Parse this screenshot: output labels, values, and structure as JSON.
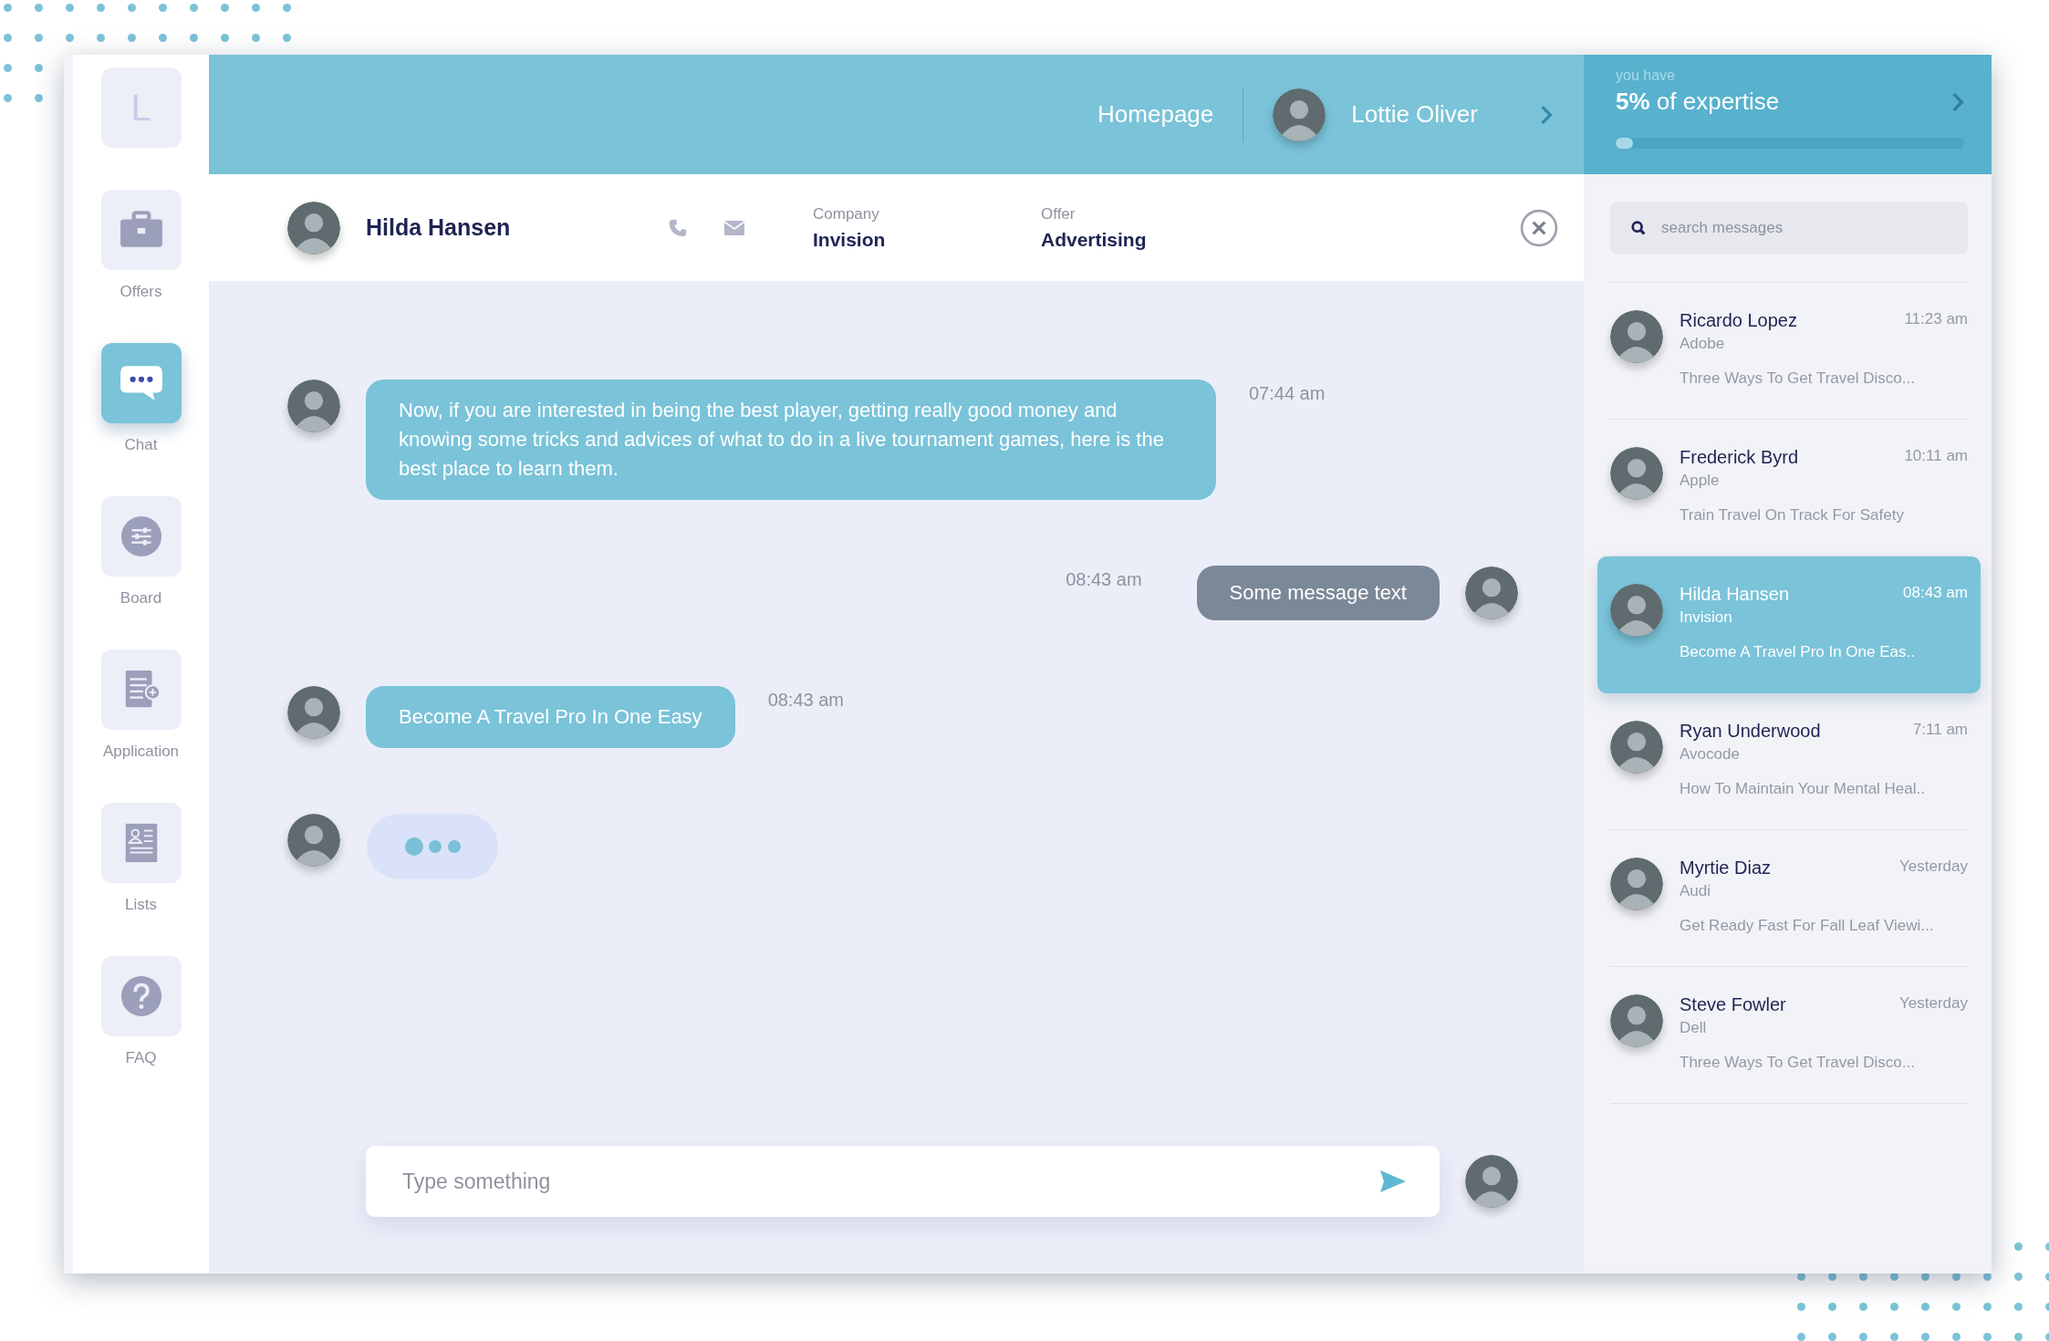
{
  "sidebar": {
    "logo": "L",
    "items": [
      {
        "kind": "offers",
        "label": "Offers",
        "selected": false
      },
      {
        "kind": "chat",
        "label": "Chat",
        "selected": true
      },
      {
        "kind": "board",
        "label": "Board",
        "selected": false
      },
      {
        "kind": "application",
        "label": "Application",
        "selected": false
      },
      {
        "kind": "lists",
        "label": "Lists",
        "selected": false
      },
      {
        "kind": "faq",
        "label": "FAQ",
        "selected": false
      }
    ]
  },
  "top_bar": {
    "link": "Homepage",
    "user": "Lottie Oliver"
  },
  "expertise": {
    "caption": "you have",
    "title": "**5%** of expertise",
    "level": 0.05
  },
  "chat_header": {
    "name": "Hilda Hansen",
    "fields": [
      {
        "label": "Company",
        "value": "Invision"
      },
      {
        "label": "Offer",
        "value": "Advertising"
      }
    ]
  },
  "messages": [
    {
      "kind": "incoming",
      "text": "Now, if you are interested in being the best player, getting really good money and knowing some tricks and advices of what to do in a live tournament games, here is the best place to learn them.",
      "time": "07:44 am"
    },
    {
      "kind": "outgoing",
      "text": "Some message text",
      "time": "08:43 am"
    },
    {
      "kind": "incoming",
      "text": "Become A Travel Pro In One Easy",
      "time": "08:43 am"
    },
    {
      "kind": "typing"
    }
  ],
  "composer": {
    "placeholder": "Type something"
  },
  "search": {
    "placeholder": "search messages"
  },
  "conversations": [
    {
      "name": "Ricardo Lopez",
      "company": "Adobe",
      "time": "11:23 am",
      "preview": "Three Ways To Get Travel Disco...",
      "selected": false
    },
    {
      "name": "Frederick Byrd",
      "company": "Apple",
      "time": "10:11 am",
      "preview": "Train Travel On Track For Safety",
      "selected": false
    },
    {
      "name": "Hilda Hansen",
      "company": "Invision",
      "time": "08:43 am",
      "preview": "Become A Travel Pro In One Eas..",
      "selected": true
    },
    {
      "name": "Ryan Underwood",
      "company": "Avocode",
      "time": "7:11 am",
      "preview": "How To Maintain Your Mental Heal..",
      "selected": false
    },
    {
      "name": "Myrtie Diaz",
      "company": "Audi",
      "time": "Yesterday",
      "preview": "Get Ready Fast For Fall Leaf Viewi...",
      "selected": false
    },
    {
      "name": "Steve Fowler",
      "company": "Dell",
      "time": "Yesterday",
      "preview": "Three Ways To Get Travel Disco...",
      "selected": false
    }
  ]
}
